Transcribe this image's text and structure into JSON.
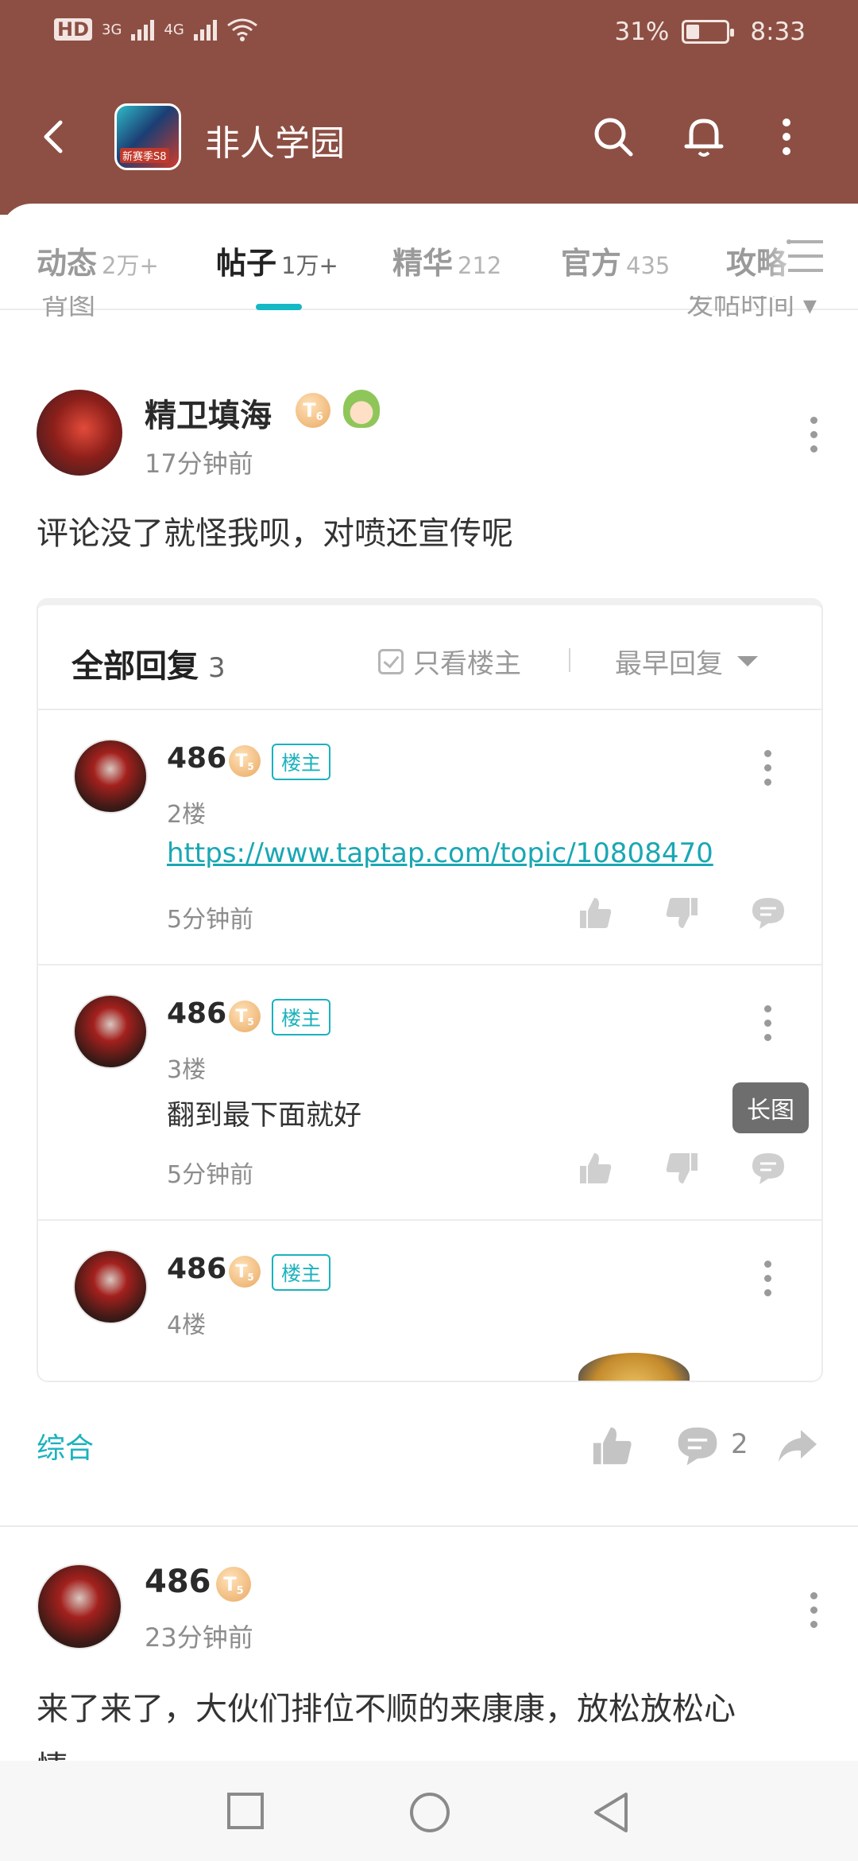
{
  "status_bar": {
    "network_hd": "HD",
    "net1": "3G",
    "net2": "4G",
    "battery": "31%",
    "time": "8:33"
  },
  "header": {
    "title": "非人学园",
    "icon_tag": "新赛季S8"
  },
  "tabs": [
    {
      "label": "动态",
      "count": "2万+"
    },
    {
      "label": "帖子",
      "count": "1万+"
    },
    {
      "label": "精华",
      "count": "212"
    },
    {
      "label": "官方",
      "count": "435"
    },
    {
      "label": "攻略",
      "count": ""
    }
  ],
  "filter_peek": {
    "left": "背图",
    "right": "发帖时间 ▾"
  },
  "post1": {
    "author": "精卫填海",
    "level": "T",
    "level_num": "6",
    "time": "17分钟前",
    "text": "评论没了就怪我呗，对喷还宣传呢"
  },
  "replies_box": {
    "title": "全部回复",
    "count": "3",
    "only_op": "只看楼主",
    "sort": "最早回复",
    "long_image": "长图",
    "items": [
      {
        "author": "486",
        "level": "T",
        "level_num": "5",
        "op_tag": "楼主",
        "floor": "2楼",
        "link": "https://www.taptap.com/topic/10808470",
        "time": "5分钟前"
      },
      {
        "author": "486",
        "level": "T",
        "level_num": "5",
        "op_tag": "楼主",
        "floor": "3楼",
        "text": "翻到最下面就好",
        "time": "5分钟前"
      },
      {
        "author": "486",
        "level": "T",
        "level_num": "5",
        "op_tag": "楼主",
        "floor": "4楼"
      }
    ]
  },
  "post_footer": {
    "category": "综合",
    "comments": "2"
  },
  "post2": {
    "author": "486",
    "level": "T",
    "level_num": "5",
    "time": "23分钟前",
    "text_line1": "来了来了，大伙们排位不顺的来康康，放松放松心",
    "text_line2": "情"
  },
  "colors": {
    "header_bg": "#8d4f44",
    "accent": "#15b8c4"
  }
}
